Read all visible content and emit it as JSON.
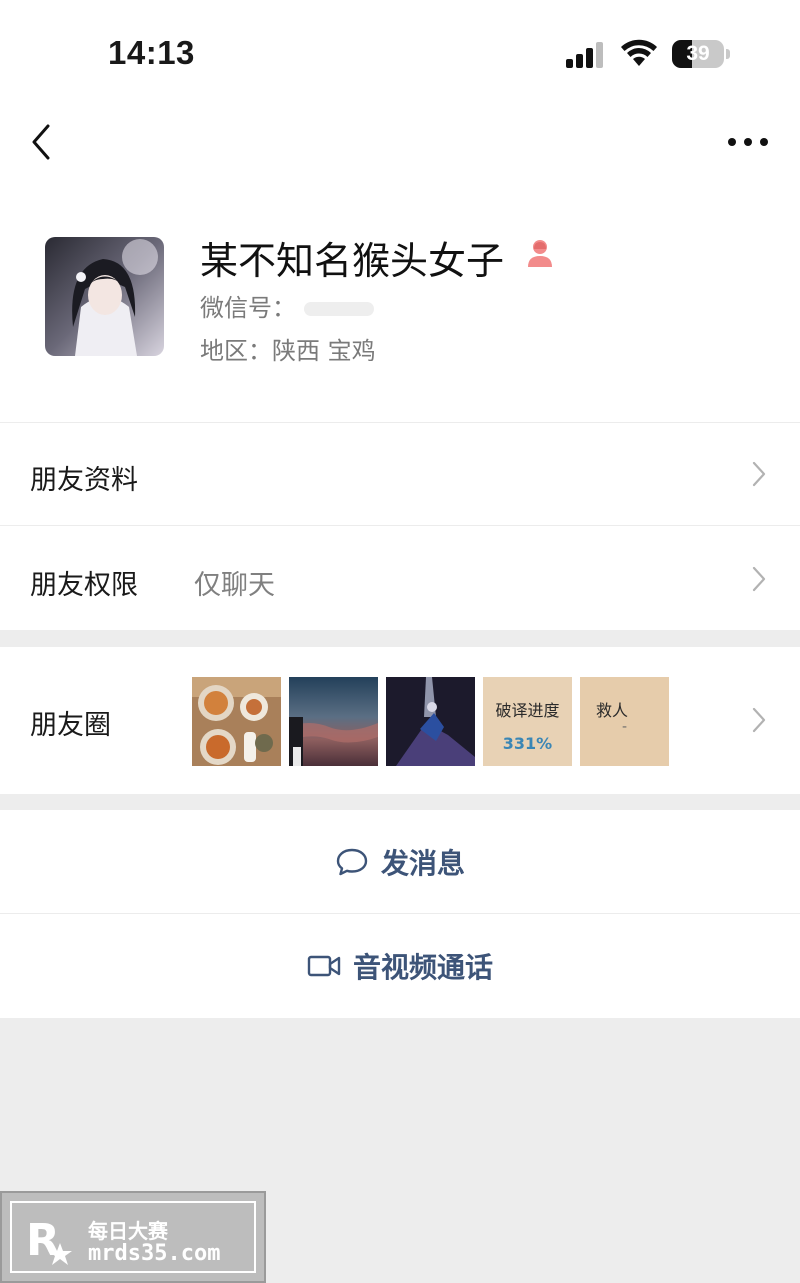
{
  "status_bar": {
    "time": "14:13",
    "battery_level": "39",
    "icons": [
      "cellular-signal-icon",
      "wifi-icon",
      "battery-icon"
    ]
  },
  "nav": {
    "back_icon": "chevron-left-icon",
    "more_icon": "more-dots-icon"
  },
  "profile": {
    "nickname": "某不知名猴头女子",
    "gender_icon": "female-user-icon",
    "wechat_id_label": "微信号：",
    "region": "地区：陕西 宝鸡"
  },
  "rows": {
    "friend_profile": {
      "label": "朋友资料"
    },
    "friend_permissions": {
      "label": "朋友权限",
      "value": "仅聊天"
    },
    "moments": {
      "label": "朋友圈",
      "thumbnails": [
        {
          "kind": "photo-food"
        },
        {
          "kind": "photo-sky"
        },
        {
          "kind": "photo-night"
        },
        {
          "kind": "text-card",
          "line1": "破译进度",
          "line2": "331%"
        },
        {
          "kind": "text-card",
          "line1": "救人",
          "line2": "-"
        }
      ]
    }
  },
  "actions": {
    "send_message": {
      "label": "发消息",
      "icon": "chat-bubble-icon"
    },
    "video_call": {
      "label": "音视频通话",
      "icon": "video-camera-icon"
    }
  },
  "watermark": {
    "title": "每日大赛",
    "url": "mrds35.com"
  },
  "colors": {
    "accent_text": "#3d5478",
    "background": "#ededed",
    "gender_icon": "#f28b8b"
  }
}
